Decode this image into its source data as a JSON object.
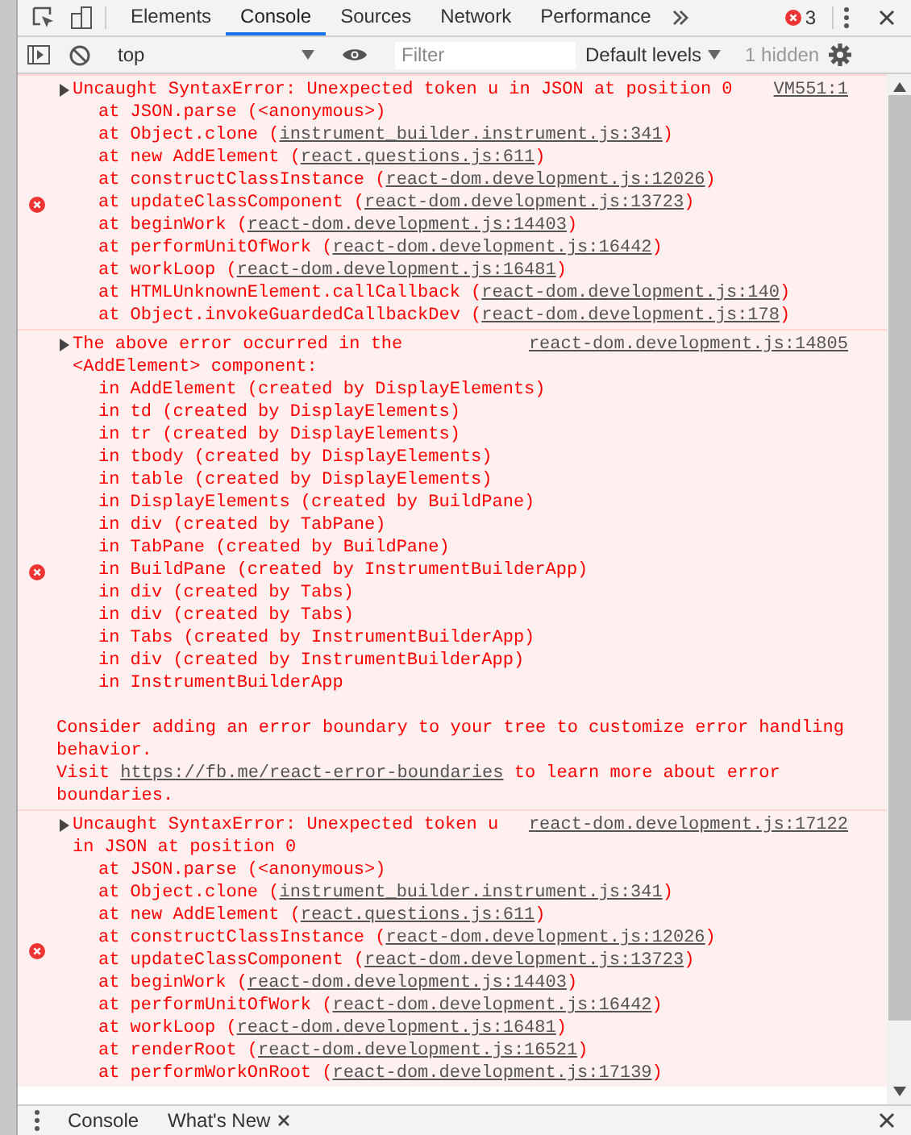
{
  "tabs": [
    {
      "label": "Elements",
      "selected": false
    },
    {
      "label": "Console",
      "selected": true
    },
    {
      "label": "Sources",
      "selected": false
    },
    {
      "label": "Network",
      "selected": false
    },
    {
      "label": "Performance",
      "selected": false
    }
  ],
  "error_count": "3",
  "toolbar": {
    "context": "top",
    "filter_placeholder": "Filter",
    "levels": "Default levels",
    "hidden": "1 hidden"
  },
  "messages": [
    {
      "source": "VM551:1",
      "text": "Uncaught SyntaxError: Unexpected token u in JSON at position 0",
      "lines": [
        {
          "kind": "frame",
          "text": "at JSON.parse (<anonymous>)"
        },
        {
          "kind": "frame",
          "text": "at Object.clone (",
          "link": "instrument_builder.instrument.js:341",
          "after": ")"
        },
        {
          "kind": "frame",
          "text": "at new AddElement (",
          "link": "react.questions.js:611",
          "after": ")"
        },
        {
          "kind": "frame",
          "text": "at constructClassInstance (",
          "link": "react-dom.development.js:12026",
          "after": ")"
        },
        {
          "kind": "frame",
          "text": "at updateClassComponent (",
          "link": "react-dom.development.js:13723",
          "after": ")"
        },
        {
          "kind": "frame",
          "text": "at beginWork (",
          "link": "react-dom.development.js:14403",
          "after": ")"
        },
        {
          "kind": "frame",
          "text": "at performUnitOfWork (",
          "link": "react-dom.development.js:16442",
          "after": ")"
        },
        {
          "kind": "frame",
          "text": "at workLoop (",
          "link": "react-dom.development.js:16481",
          "after": ")"
        },
        {
          "kind": "frame",
          "text": "at HTMLUnknownElement.callCallback (",
          "link": "react-dom.development.js:140",
          "after": ")"
        },
        {
          "kind": "frame",
          "text": "at Object.invokeGuardedCallbackDev (",
          "link": "react-dom.development.js:178",
          "after": ")"
        }
      ]
    },
    {
      "source": "react-dom.development.js:14805",
      "text": "The above error occurred in the <AddElement> component:",
      "lines": [
        {
          "kind": "frame",
          "text": "in AddElement (created by DisplayElements)"
        },
        {
          "kind": "frame",
          "text": "in td (created by DisplayElements)"
        },
        {
          "kind": "frame",
          "text": "in tr (created by DisplayElements)"
        },
        {
          "kind": "frame",
          "text": "in tbody (created by DisplayElements)"
        },
        {
          "kind": "frame",
          "text": "in table (created by DisplayElements)"
        },
        {
          "kind": "frame",
          "text": "in DisplayElements (created by BuildPane)"
        },
        {
          "kind": "frame",
          "text": "in div (created by TabPane)"
        },
        {
          "kind": "frame",
          "text": "in TabPane (created by BuildPane)"
        },
        {
          "kind": "frame",
          "text": "in BuildPane (created by InstrumentBuilderApp)"
        },
        {
          "kind": "frame",
          "text": "in div (created by Tabs)"
        },
        {
          "kind": "frame",
          "text": "in div (created by Tabs)"
        },
        {
          "kind": "frame",
          "text": "in Tabs (created by InstrumentBuilderApp)"
        },
        {
          "kind": "frame",
          "text": "in div (created by InstrumentBuilderApp)"
        },
        {
          "kind": "frame",
          "text": "in InstrumentBuilderApp"
        },
        {
          "kind": "note",
          "text": "Consider adding an error boundary to your tree to customize error handling behavior."
        },
        {
          "kind": "note",
          "text": "Visit ",
          "link": "https://fb.me/react-error-boundaries",
          "after": " to learn more about error boundaries."
        }
      ]
    },
    {
      "source": "react-dom.development.js:17122",
      "text": "Uncaught SyntaxError: Unexpected token u in JSON at position 0",
      "lines": [
        {
          "kind": "frame",
          "text": "at JSON.parse (<anonymous>)"
        },
        {
          "kind": "frame",
          "text": "at Object.clone (",
          "link": "instrument_builder.instrument.js:341",
          "after": ")"
        },
        {
          "kind": "frame",
          "text": "at new AddElement (",
          "link": "react.questions.js:611",
          "after": ")"
        },
        {
          "kind": "frame",
          "text": "at constructClassInstance (",
          "link": "react-dom.development.js:12026",
          "after": ")"
        },
        {
          "kind": "frame",
          "text": "at updateClassComponent (",
          "link": "react-dom.development.js:13723",
          "after": ")"
        },
        {
          "kind": "frame",
          "text": "at beginWork (",
          "link": "react-dom.development.js:14403",
          "after": ")"
        },
        {
          "kind": "frame",
          "text": "at performUnitOfWork (",
          "link": "react-dom.development.js:16442",
          "after": ")"
        },
        {
          "kind": "frame",
          "text": "at workLoop (",
          "link": "react-dom.development.js:16481",
          "after": ")"
        },
        {
          "kind": "frame",
          "text": "at renderRoot (",
          "link": "react-dom.development.js:16521",
          "after": ")"
        },
        {
          "kind": "frame",
          "text": "at performWorkOnRoot (",
          "link": "react-dom.development.js:17139",
          "after": ")"
        }
      ]
    }
  ],
  "drawer": {
    "tabs": [
      {
        "label": "Console",
        "closable": false
      },
      {
        "label": "What's New",
        "closable": true
      }
    ]
  }
}
